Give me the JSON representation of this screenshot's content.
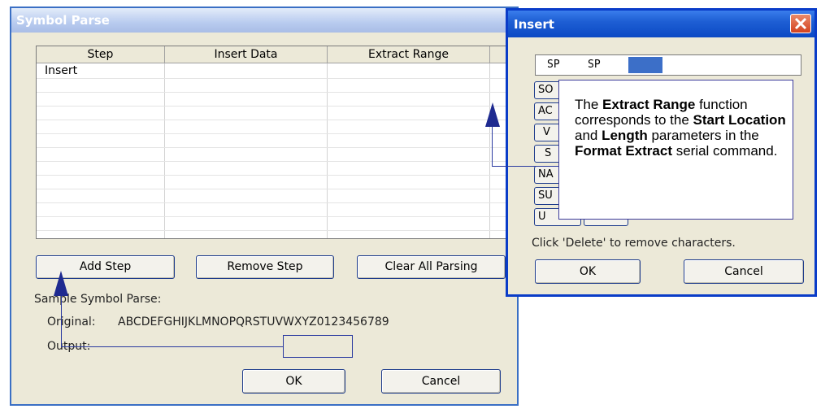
{
  "symbol_parse": {
    "title": "Symbol Parse",
    "columns": [
      "Step",
      "Insert Data",
      "Extract Range",
      ""
    ],
    "rows": [
      [
        "Insert",
        "",
        "",
        ""
      ]
    ],
    "buttons": {
      "add_step": "Add Step",
      "remove_step": "Remove Step",
      "clear_all": "Clear All Parsing",
      "ok": "OK",
      "cancel": "Cancel"
    },
    "sample_heading": "Sample Symbol Parse:",
    "original_label": "Original:",
    "original_value": "ABCDEFGHIJKLMNOPQRSTUVWXYZ0123456789",
    "output_label": "Output:"
  },
  "insert_dialog": {
    "title": "Insert",
    "characters": [
      "SP",
      "SP"
    ],
    "char_buttons": [
      "SO",
      "AC",
      "V",
      "S",
      "NA",
      "SU",
      "U"
    ],
    "hint": "Click 'Delete' to remove characters.",
    "ok": "OK",
    "cancel": "Cancel"
  },
  "callout": {
    "t1": "The ",
    "b1": "Extract Range",
    "t2": " function corresponds to the ",
    "b2": "Start Location",
    "t3": " and ",
    "b3": "Length",
    "t4": " parameters in the ",
    "b4": "Format Extract",
    "t5": " serial command."
  },
  "colors": {
    "window_face": "#ece9d8",
    "accent_blue": "#0a3cc8",
    "annotation_line": "#2a3aa0",
    "close_red": "#d4421e"
  },
  "icons": {
    "close": "close-x-icon",
    "arrow": "arrow-up-icon"
  }
}
